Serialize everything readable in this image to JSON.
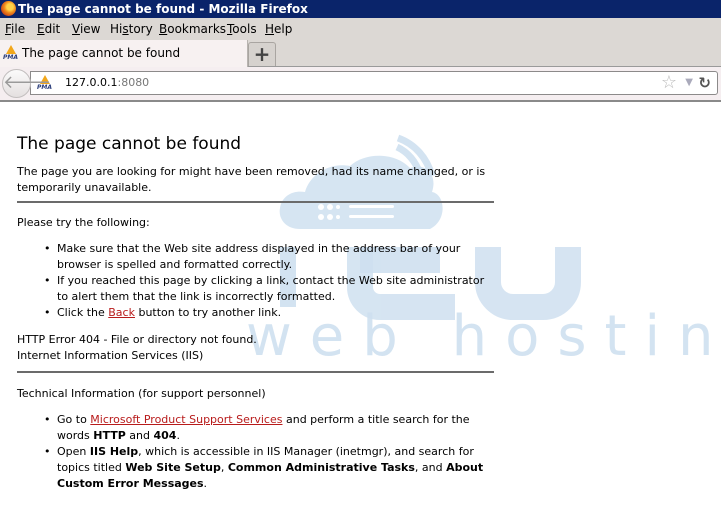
{
  "window": {
    "title": "The page cannot be found - Mozilla Firefox",
    "app_icon": "firefox-icon"
  },
  "menubar": {
    "items": [
      {
        "label": "File",
        "accesskey": "F"
      },
      {
        "label": "Edit",
        "accesskey": "E"
      },
      {
        "label": "View",
        "accesskey": "V"
      },
      {
        "label": "History",
        "accesskey": "s"
      },
      {
        "label": "Bookmarks",
        "accesskey": "B"
      },
      {
        "label": "Tools",
        "accesskey": "T"
      },
      {
        "label": "Help",
        "accesskey": "H"
      }
    ]
  },
  "tabs": [
    {
      "title": "The page cannot be found",
      "favicon": "pma-icon",
      "active": true
    }
  ],
  "new_tab_label": "+",
  "navbar": {
    "back_icon": "back-arrow-icon",
    "url_host": "127.0.0.1",
    "url_port": ":8080",
    "site_icon": "pma-icon",
    "pma_text": "PMA",
    "bookmark_icon": "star-icon",
    "history_dropdown_icon": "dropdown-icon",
    "reload_icon": "reload-icon"
  },
  "page": {
    "heading": "The page cannot be found",
    "intro": "The page you are looking for might have been removed, had its name changed, or is temporarily unavailable.",
    "try_heading": "Please try the following:",
    "try_items": [
      {
        "text": "Make sure that the Web site address displayed in the address bar of your browser is spelled and formatted correctly."
      },
      {
        "text": "If you reached this page by clicking a link, contact the Web site administrator to alert them that the link is incorrectly formatted."
      },
      {
        "before": "Click the ",
        "link": "Back",
        "after": " button to try another link."
      }
    ],
    "error_line": "HTTP Error 404 - File or directory not found.",
    "server_line": "Internet Information Services (IIS)",
    "tech_heading": "Technical Information (for support personnel)",
    "tech_items": {
      "item1": {
        "before": "Go to ",
        "link": "Microsoft Product Support Services",
        "mid": " and perform a title search for the words ",
        "bold1": "HTTP",
        "and": " and ",
        "bold2": "404",
        "end": "."
      },
      "item2": {
        "before": "Open ",
        "bold1": "IIS Help",
        "mid": ", which is accessible in IIS Manager (inetmgr), and search for topics titled ",
        "bold2": "Web Site Setup",
        "sep": ", ",
        "bold3": "Common Administrative Tasks",
        "and": ", and ",
        "bold4": "About Custom Error Messages",
        "end": "."
      }
    },
    "link_color": "#b81b1b"
  },
  "watermark": {
    "brand_top": "ECU",
    "brand_bottom": "web hosting",
    "color": "#c9dcef"
  }
}
